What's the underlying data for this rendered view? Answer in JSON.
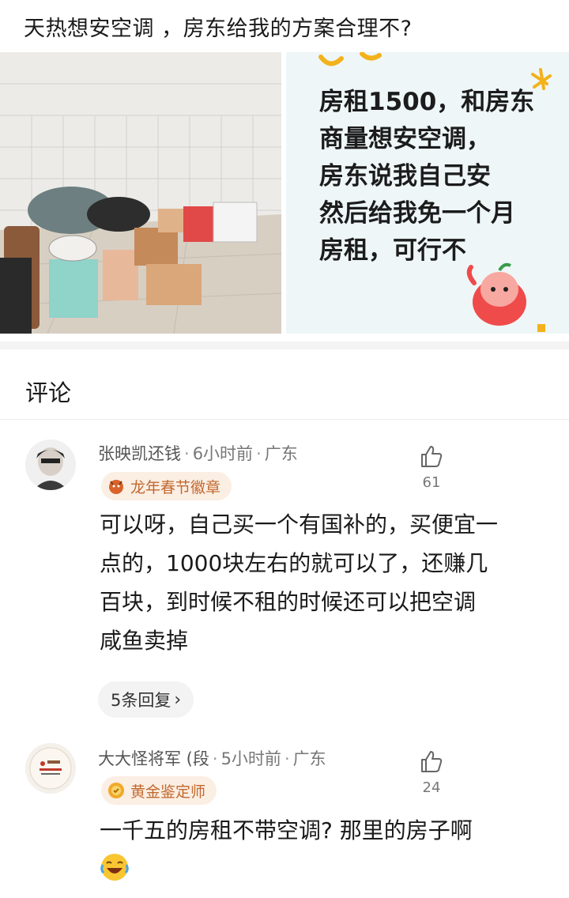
{
  "post": {
    "title": "天热想安空调 ，房东给我的方案合理不?",
    "meme_lines": [
      "房租1500，和房东",
      "商量想安空调，",
      "房东说我自己安",
      "然后给我免一个月",
      "房租，可行不"
    ]
  },
  "comments_section": {
    "title": "评论"
  },
  "comments": [
    {
      "username": "张映凯还钱",
      "time": "6小时前",
      "location": "广东",
      "badge": "龙年春节徽章",
      "likes": "61",
      "body_lines": [
        "可以呀，自己买一个有国补的，买便宜一",
        "点的，1000块左右的就可以了，还赚几",
        "百块，到时候不租的时候还可以把空调",
        "咸鱼卖掉"
      ],
      "replies_label": "5条回复"
    },
    {
      "username": "大大怪将军 (段",
      "time": "5小时前",
      "location": "广东",
      "badge": "黄金鉴定师",
      "likes": "24",
      "body_lines": [
        "一千五的房租不带空调? 那里的房子啊"
      ]
    }
  ],
  "colors": {
    "badge_bg": "#fbeee3",
    "badge_text": "#c1692f",
    "highlight": "#ffb3a6"
  }
}
